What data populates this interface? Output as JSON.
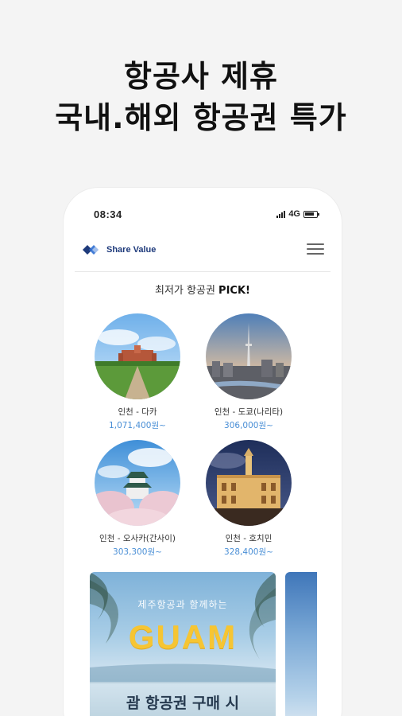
{
  "headline": {
    "line1": "항공사 제휴",
    "line2": "국내.해외 항공권 특가"
  },
  "status_bar": {
    "time": "08:34",
    "network": "4G"
  },
  "app": {
    "brand": "Share Value"
  },
  "section": {
    "title_prefix": "최저가 항공권 ",
    "title_bold": "PICK!"
  },
  "destinations": [
    {
      "name": "인천 - 다카",
      "price": "1,071,400원~"
    },
    {
      "name": "인천 - 도쿄(나리타)",
      "price": "306,000원~"
    },
    {
      "name": "인천 - 오사카(간사이)",
      "price": "303,300원~"
    },
    {
      "name": "인천 - 호치민",
      "price": "328,400원~"
    }
  ],
  "banner": {
    "subtitle": "제주항공과 함께하는",
    "title": "GUAM",
    "bottom": "괌 항공권 구매 시"
  },
  "colors": {
    "price": "#4a8fd6",
    "brand": "#1e3a7b",
    "banner_title": "#f6c533"
  }
}
